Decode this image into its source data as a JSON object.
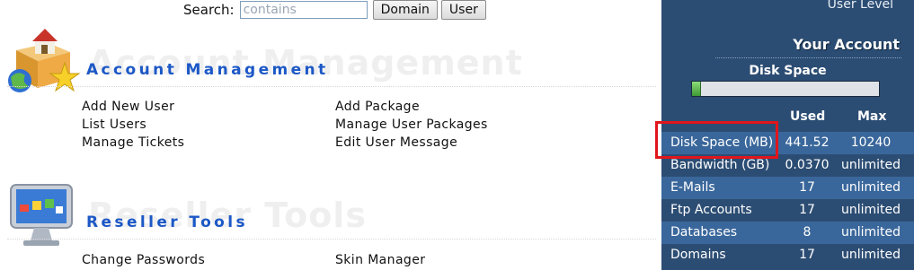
{
  "search": {
    "label": "Search:",
    "placeholder": "contains",
    "domain_button": "Domain",
    "user_button": "User"
  },
  "account_management": {
    "title": "Account Management",
    "links": [
      "Add New User",
      "List Users",
      "Manage Tickets",
      "Add Package",
      "Manage User Packages",
      "Edit User Message"
    ]
  },
  "reseller_tools": {
    "title": "Reseller Tools",
    "links": [
      "Change Passwords",
      "Skin Manager"
    ]
  },
  "panel": {
    "user_level": "User Level",
    "your_account": "Your Account",
    "disk_space_title": "Disk Space",
    "disk_usage_fraction": 0.043,
    "col_used": "Used",
    "col_max": "Max",
    "rows": [
      {
        "label": "Disk Space (MB)",
        "used": "441.52",
        "max": "10240"
      },
      {
        "label": "Bandwidth (GB)",
        "used": "0.0370",
        "max": "unlimited"
      },
      {
        "label": "E-Mails",
        "used": "17",
        "max": "unlimited"
      },
      {
        "label": "Ftp Accounts",
        "used": "17",
        "max": "unlimited"
      },
      {
        "label": "Databases",
        "used": "8",
        "max": "unlimited"
      },
      {
        "label": "Domains",
        "used": "17",
        "max": "unlimited"
      }
    ]
  },
  "colors": {
    "panel_bg": "#2c4d73",
    "panel_row_alt": "#3a679b",
    "section_title": "#1c58c6",
    "highlight": "#e0161c"
  }
}
